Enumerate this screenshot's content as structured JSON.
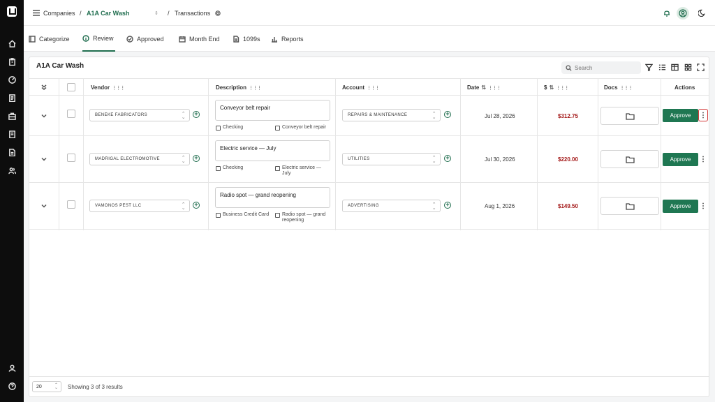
{
  "topbar": {
    "companies_label": "Companies",
    "separator": "/",
    "company_name": "A1A Car Wash",
    "page_name": "Transactions"
  },
  "tabs": [
    {
      "label": "Categorize",
      "icon": "ledger-icon"
    },
    {
      "label": "Review",
      "icon": "info-icon",
      "active": true
    },
    {
      "label": "Approved",
      "icon": "check-circle-icon"
    },
    {
      "label": "Month End",
      "icon": "calendar-icon"
    },
    {
      "label": "1099s",
      "icon": "document-icon"
    },
    {
      "label": "Reports",
      "icon": "bar-chart-icon"
    }
  ],
  "panel": {
    "title": "A1A Car Wash",
    "search_placeholder": "Search"
  },
  "columns": {
    "vendor": "Vendor",
    "description": "Description",
    "account": "Account",
    "date": "Date",
    "amount": "$",
    "docs": "Docs",
    "actions": "Actions"
  },
  "rows": [
    {
      "vendor": "BENEKE FABRICATORS",
      "description": "Conveyor belt repair",
      "source": "Checking",
      "memo": "Conveyor belt repair",
      "account": "REPAIRS & MAINTENANCE",
      "date": "Jul 28, 2026",
      "amount": "$312.75",
      "approve_label": "Approve"
    },
    {
      "vendor": "MADRIGAL ELECTROMOTIVE",
      "description": "Electric service — July",
      "source": "Checking",
      "memo": "Electric service — July",
      "account": "UTILITIES",
      "date": "Jul 30, 2026",
      "amount": "$220.00",
      "approve_label": "Approve"
    },
    {
      "vendor": "VAMONOS PEST LLC",
      "description": "Radio spot — grand reopening",
      "source": "Business Credit Card",
      "memo": "Radio spot — grand reopening",
      "account": "ADVERTISING",
      "date": "Aug 1, 2026",
      "amount": "$149.50",
      "approve_label": "Approve"
    }
  ],
  "footer": {
    "page_size": "20",
    "showing_text": "Showing 3 of 3 results"
  },
  "colors": {
    "brand_green": "#1f6d4e",
    "amount_red": "#a51b1b",
    "sidebar_bg": "#0d0d0d"
  }
}
